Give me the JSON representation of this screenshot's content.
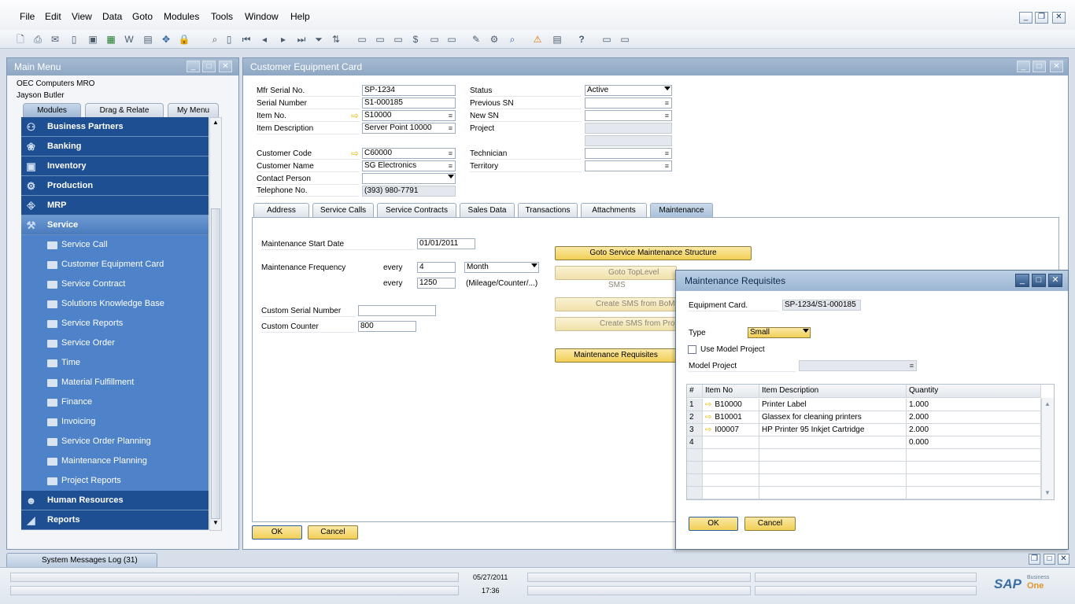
{
  "menubar": [
    "File",
    "Edit",
    "View",
    "Data",
    "Goto",
    "Modules",
    "Tools",
    "Window",
    "Help"
  ],
  "main_menu": {
    "title": "Main Menu",
    "company": "OEC Computers MRO",
    "user": "Jayson Butler",
    "tabs": [
      "Modules",
      "Drag & Relate",
      "My Menu"
    ],
    "modules_top": [
      {
        "label": "Business Partners",
        "icon": "business-partners-icon"
      },
      {
        "label": "Banking",
        "icon": "banking-icon"
      },
      {
        "label": "Inventory",
        "icon": "inventory-icon"
      },
      {
        "label": "Production",
        "icon": "production-icon"
      },
      {
        "label": "MRP",
        "icon": "mrp-icon"
      },
      {
        "label": "Service",
        "icon": "service-icon"
      }
    ],
    "service_items": [
      "Service Call",
      "Customer Equipment Card",
      "Service Contract",
      "Solutions Knowledge Base",
      "Service Reports",
      "Service Order",
      "Time",
      "Material Fulfillment",
      "Finance",
      "Invoicing",
      "Service Order Planning",
      "Maintenance Planning",
      "Project Reports"
    ],
    "modules_bottom": [
      {
        "label": "Human Resources",
        "icon": "human-resources-icon"
      },
      {
        "label": "Reports",
        "icon": "reports-icon"
      }
    ]
  },
  "card": {
    "title": "Customer Equipment Card",
    "labels": {
      "mfr_serial": "Mfr Serial No.",
      "serial_number": "Serial Number",
      "item_no": "Item No.",
      "item_description": "Item Description",
      "customer_code": "Customer Code",
      "customer_name": "Customer Name",
      "contact_person": "Contact Person",
      "telephone": "Telephone No.",
      "status": "Status",
      "previous_sn": "Previous SN",
      "new_sn": "New SN",
      "project": "Project",
      "technician": "Technician",
      "territory": "Territory"
    },
    "values": {
      "mfr_serial": "SP-1234",
      "serial_number": "S1-000185",
      "item_no": "S10000",
      "item_description": "Server Point 10000",
      "customer_code": "C60000",
      "customer_name": "SG Electronics",
      "contact_person": "",
      "telephone": "(393) 980-7791",
      "status": "Active",
      "previous_sn": "",
      "new_sn": "",
      "technician": "",
      "territory": ""
    },
    "tabs": [
      "Address",
      "Service Calls",
      "Service Contracts",
      "Sales Data",
      "Transactions",
      "Attachments",
      "Maintenance"
    ],
    "maintenance": {
      "start_date_label": "Maintenance Start Date",
      "start_date": "01/01/2011",
      "frequency_label": "Maintenance Frequency",
      "every": "every",
      "freq_value": "4",
      "freq_unit": "Month",
      "counter_value": "1250",
      "counter_unit": "(Mileage/Counter/...)",
      "custom_serial_label": "Custom Serial Number",
      "custom_serial": "",
      "custom_counter_label": "Custom Counter",
      "custom_counter": "800"
    },
    "buttons": {
      "goto_structure": "Goto Service Maintenance Structure",
      "goto_toplevel": "Goto TopLevel SMS",
      "create_bom": "Create SMS from BoM",
      "create_project": "Create SMS from Pro",
      "requisites": "Maintenance Requisites",
      "ok": "OK",
      "cancel": "Cancel"
    }
  },
  "dialog": {
    "title": "Maintenance Requisites",
    "equipment_label": "Equipment Card.",
    "equipment_value": "SP-1234/S1-000185",
    "type_label": "Type",
    "type_value": "Small",
    "use_model_project": "Use Model Project",
    "model_project_label": "Model Project",
    "columns": [
      "#",
      "Item No",
      "Item Description",
      "Quantity"
    ],
    "rows": [
      {
        "n": "1",
        "item": "B10000",
        "desc": "Printer Label",
        "qty": "1.000"
      },
      {
        "n": "2",
        "item": "B10001",
        "desc": "Glassex for cleaning printers",
        "qty": "2.000"
      },
      {
        "n": "3",
        "item": "I00007",
        "desc": "HP Printer 95 Inkjet Cartridge",
        "qty": "2.000"
      },
      {
        "n": "4",
        "item": "",
        "desc": "",
        "qty": "0.000"
      }
    ],
    "ok": "OK",
    "cancel": "Cancel"
  },
  "status": {
    "messages_tab": "System Messages Log (31)",
    "date": "05/27/2011",
    "time": "17:36",
    "brand": "SAP",
    "brand_small": "Business",
    "brand_one": "One"
  },
  "colors": {
    "accent": "#1e4f92",
    "active_module": "#4a7bbd",
    "submenu": "#4f83c9",
    "button": "#f1cf55"
  }
}
